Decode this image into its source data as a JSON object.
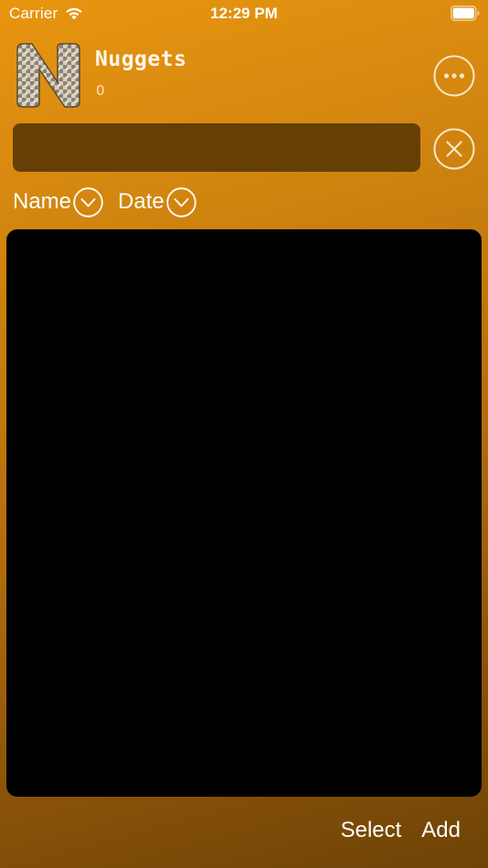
{
  "status_bar": {
    "carrier": "Carrier",
    "time": "12:29 PM",
    "wifi_icon": "wifi-icon",
    "battery_icon": "battery-icon"
  },
  "header": {
    "title": "Nuggets",
    "subtitle": "0",
    "logo_letter": "N",
    "logo_icon": "app-logo-icon",
    "more_icon": "ellipsis-circle-icon"
  },
  "search": {
    "value": "",
    "placeholder": "",
    "clear_icon": "xmark-circle-icon"
  },
  "sort": {
    "name_label": "Name",
    "date_label": "Date",
    "chevron_icon": "chevron-down-circle-icon"
  },
  "list": {
    "items": []
  },
  "toolbar": {
    "select_label": "Select",
    "add_label": "Add"
  },
  "colors": {
    "background_top": "#e8950f",
    "background_bottom": "#6e4306",
    "search_field": "#663f07",
    "list_panel": "#000000",
    "text": "#ffffff"
  }
}
